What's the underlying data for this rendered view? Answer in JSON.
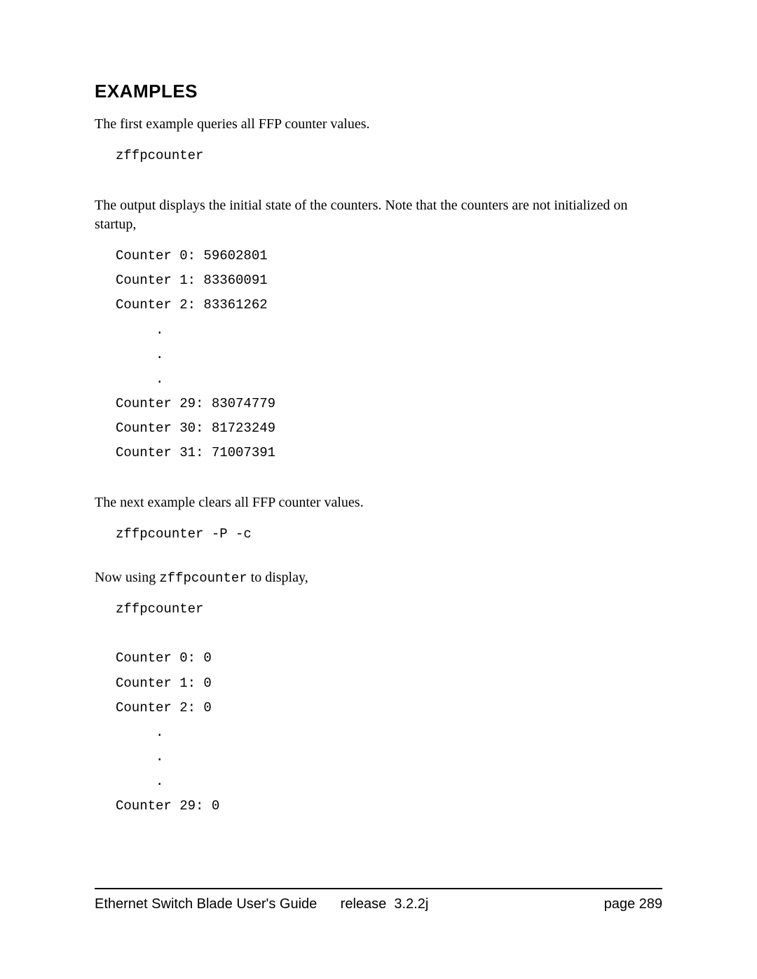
{
  "heading": "EXAMPLES",
  "para1": "The first example queries all FFP counter values.",
  "code1": "zffpcounter",
  "para2": "The output displays the initial state of the counters. Note that the counters are not initialized on startup,",
  "code2": "Counter 0: 59602801\nCounter 1: 83360091\nCounter 2: 83361262\n     .\n     .\n     .\nCounter 29: 83074779\nCounter 30: 81723249\nCounter 31: 71007391",
  "para3": "The next example clears all FFP counter values.",
  "code3": "zffpcounter -P -c",
  "para4_pre": "Now using ",
  "para4_mono": "zffpcounter",
  "para4_post": " to display,",
  "code4": "zffpcounter\n\nCounter 0: 0\nCounter 1: 0\nCounter 2: 0\n     .\n     .\n     .\nCounter 29: 0",
  "footer": {
    "title": "Ethernet Switch Blade User's Guide",
    "release": "release  3.2.2j",
    "page_label": "page  289"
  }
}
